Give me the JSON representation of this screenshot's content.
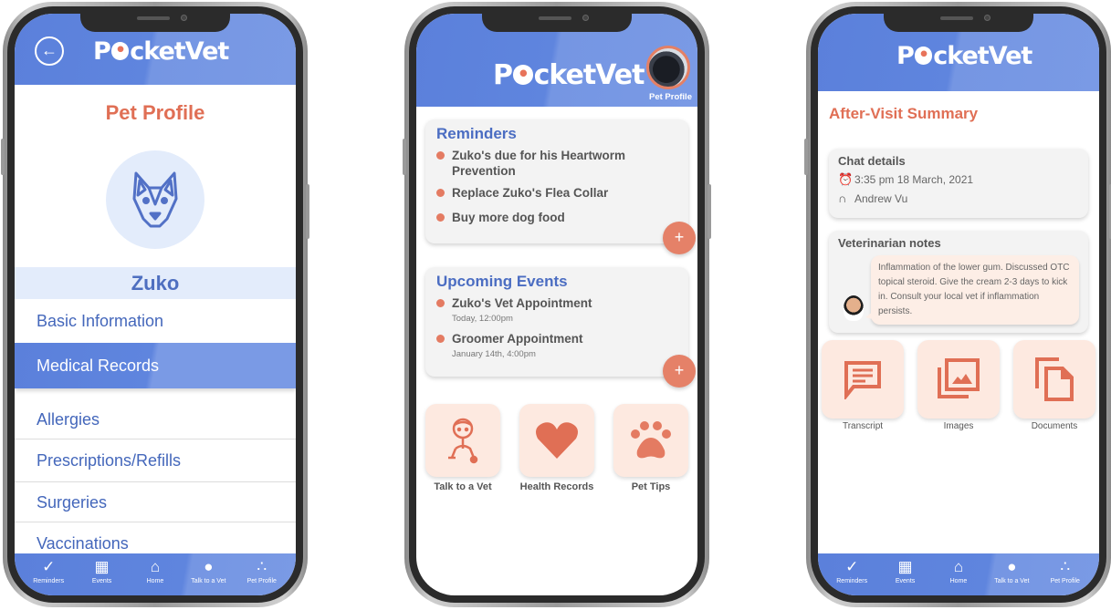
{
  "app_name": "PocketVet",
  "colors": {
    "primary_blue": "#5b80db",
    "accent_coral": "#e06f55",
    "tile_bg": "#fde9e0",
    "highlight_blue": "#e3ecfb"
  },
  "bottom_nav": [
    {
      "label": "Reminders",
      "icon": "checkmark-icon"
    },
    {
      "label": "Events",
      "icon": "calendar-icon"
    },
    {
      "label": "Home",
      "icon": "home-icon"
    },
    {
      "label": "Talk to a Vet",
      "icon": "chat-bubble-icon"
    },
    {
      "label": "Pet Profile",
      "icon": "paw-icon"
    }
  ],
  "pet_profile_screen": {
    "title": "Pet Profile",
    "pet_name": "Zuko",
    "menu": [
      {
        "label": "Basic Information"
      },
      {
        "label": "Medical Records",
        "active": true
      },
      {
        "label": "Allergies"
      },
      {
        "label": "Prescriptions/Refills"
      },
      {
        "label": "Surgeries"
      },
      {
        "label": "Vaccinations"
      }
    ]
  },
  "home_screen": {
    "avatar_label": "Pet Profile",
    "reminders": {
      "title": "Reminders",
      "items": [
        "Zuko's due for his Heartworm Prevention",
        "Replace Zuko's Flea Collar",
        "Buy more dog food"
      ]
    },
    "events": {
      "title": "Upcoming Events",
      "items": [
        {
          "name": "Zuko's Vet Appointment",
          "when": "Today, 12:00pm"
        },
        {
          "name": "Groomer Appointment",
          "when": "January 14th, 4:00pm"
        }
      ]
    },
    "add_label": "+",
    "tiles": [
      {
        "label": "Talk to a Vet",
        "icon": "vet-icon"
      },
      {
        "label": "Health Records",
        "icon": "heart-icon"
      },
      {
        "label": "Pet Tips",
        "icon": "paw-icon"
      }
    ]
  },
  "summary_screen": {
    "title": "After-Visit Summary",
    "chat_details": {
      "title": "Chat details",
      "datetime": "3:35 pm 18 March, 2021",
      "vet_name": "Andrew Vu"
    },
    "notes": {
      "title": "Veterinarian notes",
      "text": "Inflammation of the lower gum. Discussed OTC topical steroid. Give the cream 2-3 days to kick in. Consult your local vet if inflammation persists."
    },
    "tiles": [
      {
        "label": "Transcript",
        "icon": "transcript-icon"
      },
      {
        "label": "Images",
        "icon": "images-icon"
      },
      {
        "label": "Documents",
        "icon": "documents-icon"
      }
    ]
  }
}
